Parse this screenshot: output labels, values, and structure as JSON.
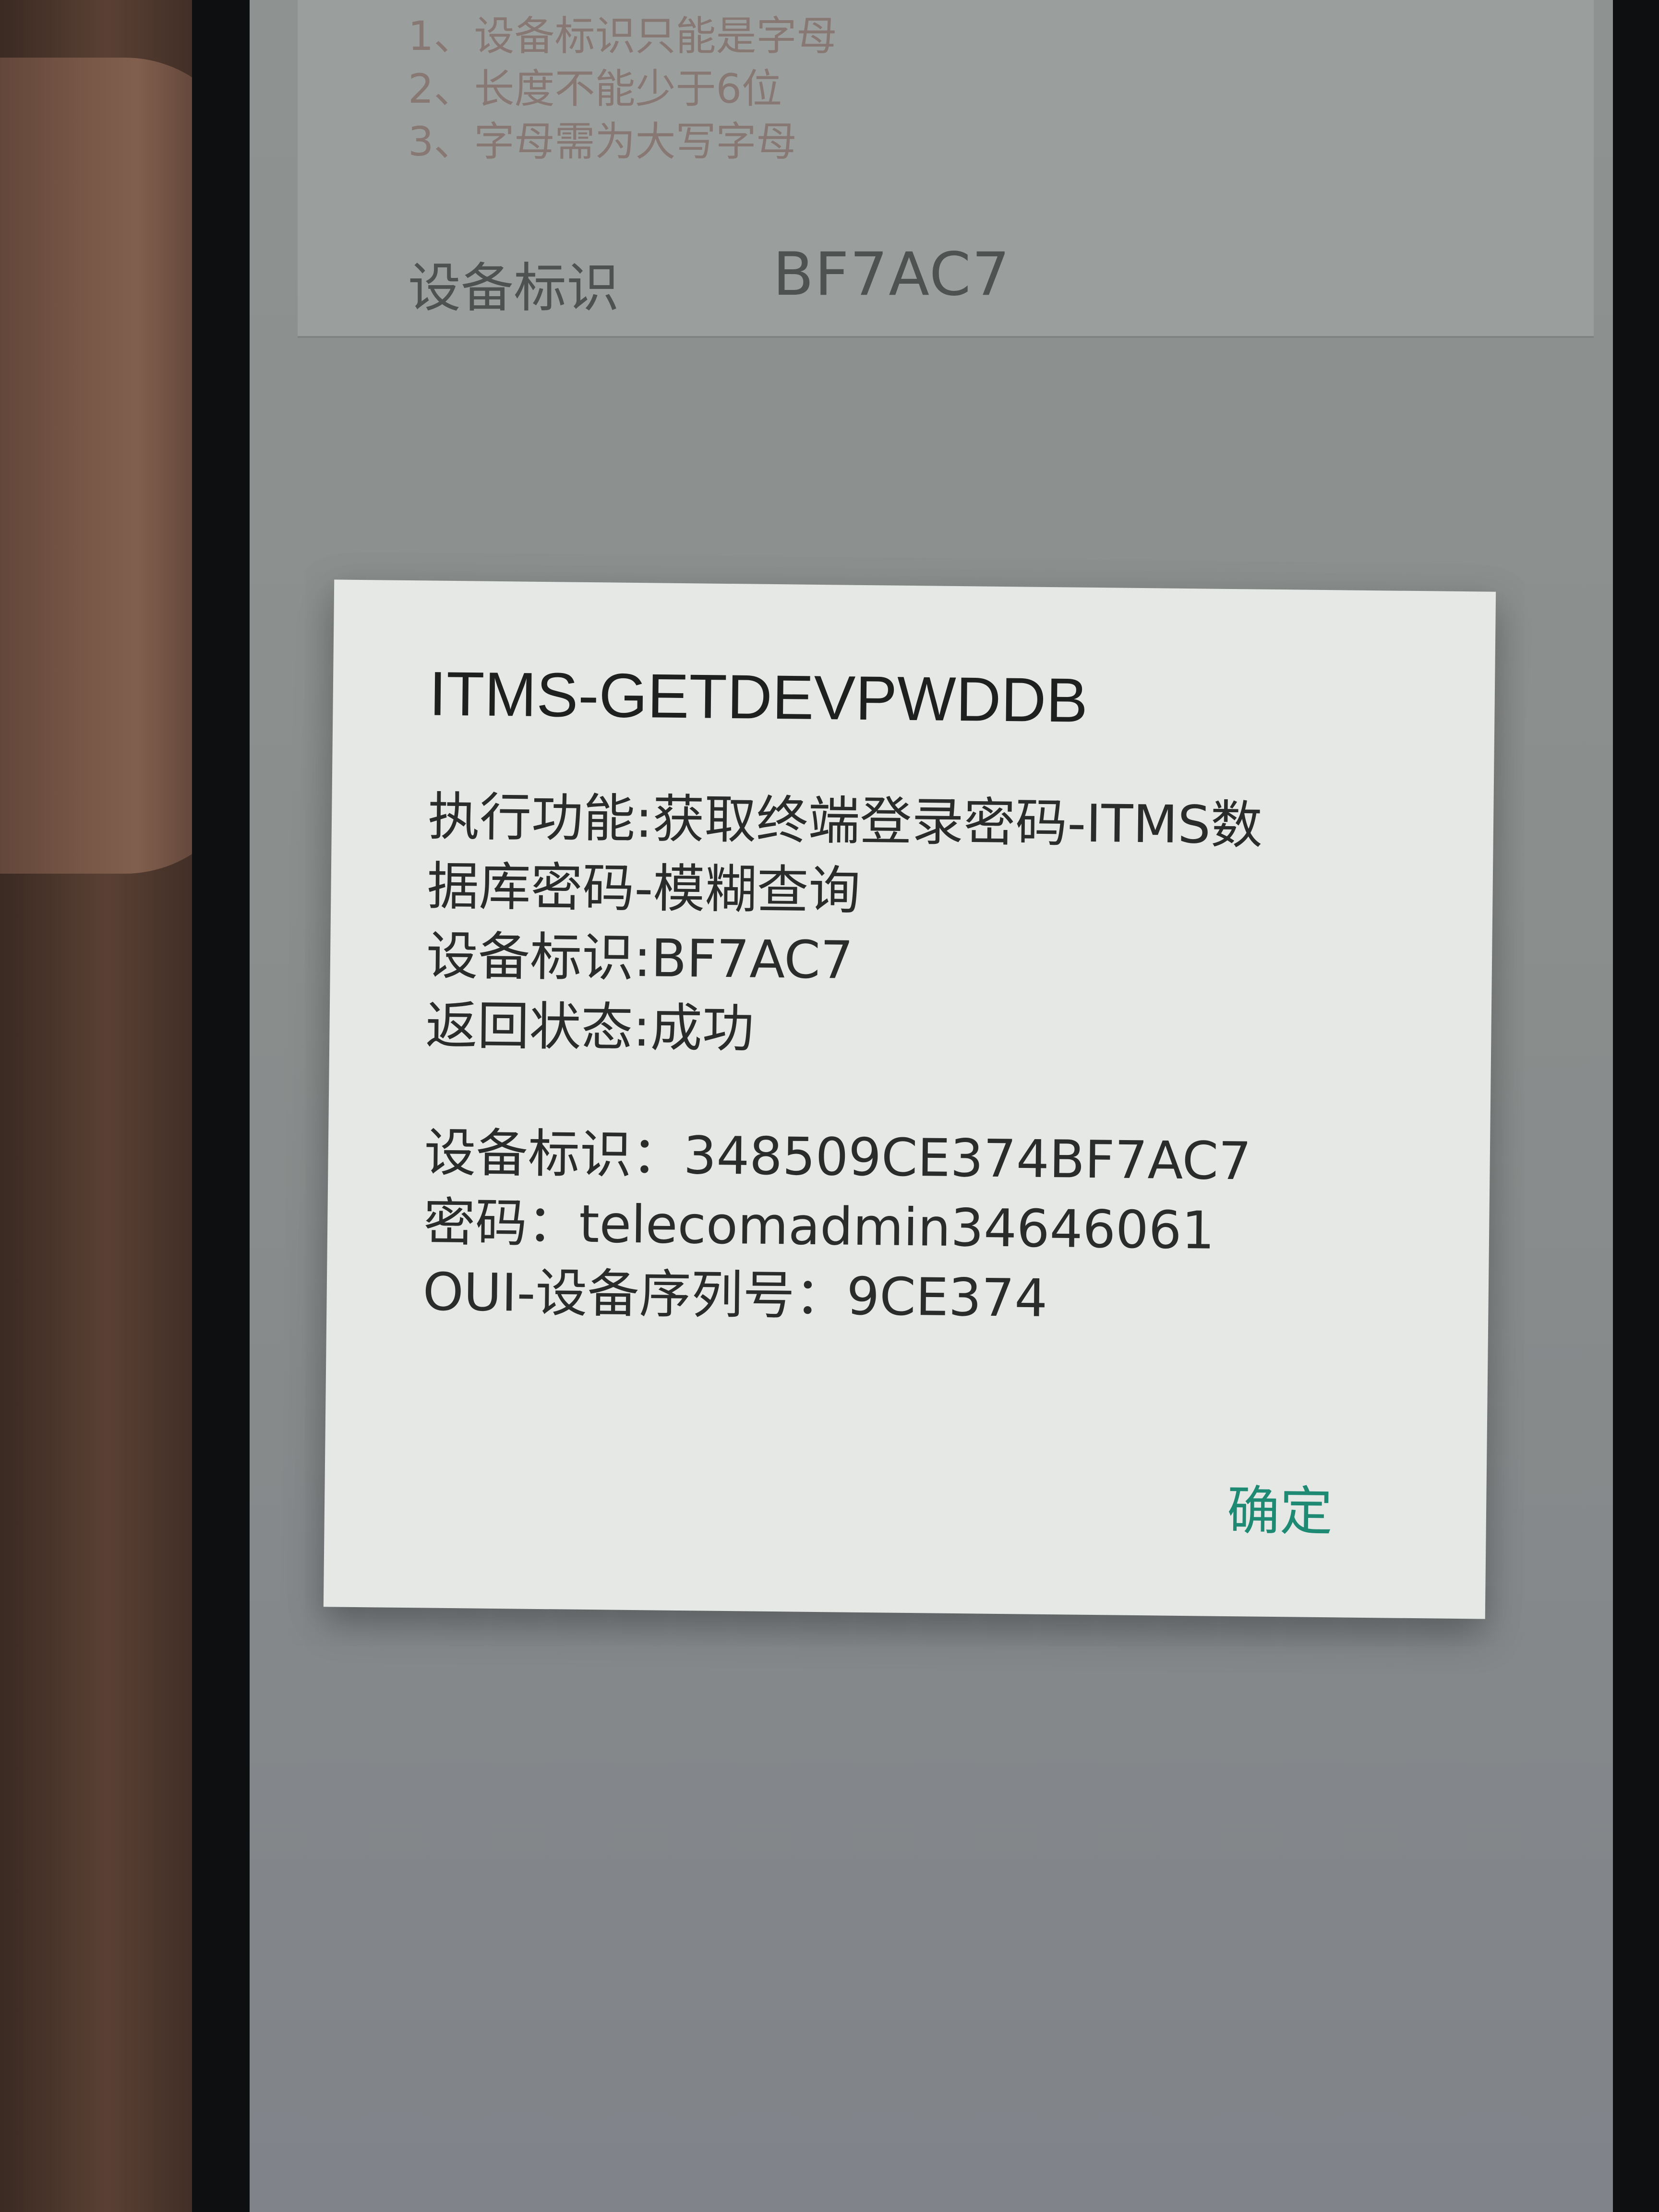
{
  "background_app": {
    "notes": [
      "1、设备标识只能是字母",
      "2、长度不能少于6位",
      "3、字母需为大写字母"
    ],
    "device_id_label": "设备标识",
    "device_id_value": "BF7AC7"
  },
  "dialog": {
    "title": "ITMS-GETDEVPWDDB",
    "lines": [
      "执行功能:获取终端登录密码-ITMS数",
      "据库密码-模糊查询",
      "设备标识:BF7AC7",
      "返回状态:成功"
    ],
    "details": [
      "设备标识：348509CE374BF7AC7",
      "密码：telecomadmin34646061",
      "OUI-设备序列号：9CE374"
    ],
    "confirm_label": "确定"
  },
  "colors": {
    "accent": "#1e8a74",
    "dialog_bg": "#e6e8e6",
    "screen_dim": "#8a8e8c"
  }
}
